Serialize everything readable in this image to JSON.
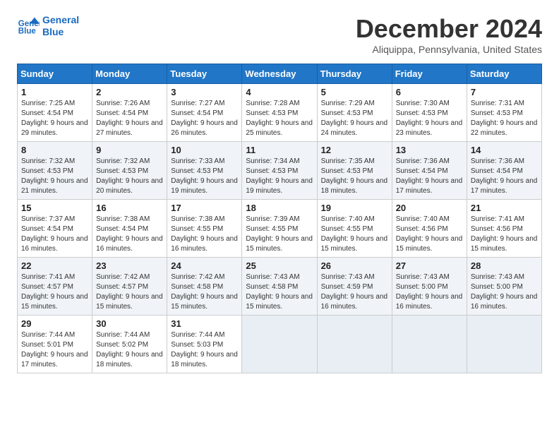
{
  "header": {
    "logo_line1": "General",
    "logo_line2": "Blue",
    "title": "December 2024",
    "subtitle": "Aliquippa, Pennsylvania, United States"
  },
  "columns": [
    "Sunday",
    "Monday",
    "Tuesday",
    "Wednesday",
    "Thursday",
    "Friday",
    "Saturday"
  ],
  "weeks": [
    [
      {
        "day": "1",
        "sunrise": "Sunrise: 7:25 AM",
        "sunset": "Sunset: 4:54 PM",
        "daylight": "Daylight: 9 hours and 29 minutes."
      },
      {
        "day": "2",
        "sunrise": "Sunrise: 7:26 AM",
        "sunset": "Sunset: 4:54 PM",
        "daylight": "Daylight: 9 hours and 27 minutes."
      },
      {
        "day": "3",
        "sunrise": "Sunrise: 7:27 AM",
        "sunset": "Sunset: 4:54 PM",
        "daylight": "Daylight: 9 hours and 26 minutes."
      },
      {
        "day": "4",
        "sunrise": "Sunrise: 7:28 AM",
        "sunset": "Sunset: 4:53 PM",
        "daylight": "Daylight: 9 hours and 25 minutes."
      },
      {
        "day": "5",
        "sunrise": "Sunrise: 7:29 AM",
        "sunset": "Sunset: 4:53 PM",
        "daylight": "Daylight: 9 hours and 24 minutes."
      },
      {
        "day": "6",
        "sunrise": "Sunrise: 7:30 AM",
        "sunset": "Sunset: 4:53 PM",
        "daylight": "Daylight: 9 hours and 23 minutes."
      },
      {
        "day": "7",
        "sunrise": "Sunrise: 7:31 AM",
        "sunset": "Sunset: 4:53 PM",
        "daylight": "Daylight: 9 hours and 22 minutes."
      }
    ],
    [
      {
        "day": "8",
        "sunrise": "Sunrise: 7:32 AM",
        "sunset": "Sunset: 4:53 PM",
        "daylight": "Daylight: 9 hours and 21 minutes."
      },
      {
        "day": "9",
        "sunrise": "Sunrise: 7:32 AM",
        "sunset": "Sunset: 4:53 PM",
        "daylight": "Daylight: 9 hours and 20 minutes."
      },
      {
        "day": "10",
        "sunrise": "Sunrise: 7:33 AM",
        "sunset": "Sunset: 4:53 PM",
        "daylight": "Daylight: 9 hours and 19 minutes."
      },
      {
        "day": "11",
        "sunrise": "Sunrise: 7:34 AM",
        "sunset": "Sunset: 4:53 PM",
        "daylight": "Daylight: 9 hours and 19 minutes."
      },
      {
        "day": "12",
        "sunrise": "Sunrise: 7:35 AM",
        "sunset": "Sunset: 4:53 PM",
        "daylight": "Daylight: 9 hours and 18 minutes."
      },
      {
        "day": "13",
        "sunrise": "Sunrise: 7:36 AM",
        "sunset": "Sunset: 4:54 PM",
        "daylight": "Daylight: 9 hours and 17 minutes."
      },
      {
        "day": "14",
        "sunrise": "Sunrise: 7:36 AM",
        "sunset": "Sunset: 4:54 PM",
        "daylight": "Daylight: 9 hours and 17 minutes."
      }
    ],
    [
      {
        "day": "15",
        "sunrise": "Sunrise: 7:37 AM",
        "sunset": "Sunset: 4:54 PM",
        "daylight": "Daylight: 9 hours and 16 minutes."
      },
      {
        "day": "16",
        "sunrise": "Sunrise: 7:38 AM",
        "sunset": "Sunset: 4:54 PM",
        "daylight": "Daylight: 9 hours and 16 minutes."
      },
      {
        "day": "17",
        "sunrise": "Sunrise: 7:38 AM",
        "sunset": "Sunset: 4:55 PM",
        "daylight": "Daylight: 9 hours and 16 minutes."
      },
      {
        "day": "18",
        "sunrise": "Sunrise: 7:39 AM",
        "sunset": "Sunset: 4:55 PM",
        "daylight": "Daylight: 9 hours and 15 minutes."
      },
      {
        "day": "19",
        "sunrise": "Sunrise: 7:40 AM",
        "sunset": "Sunset: 4:55 PM",
        "daylight": "Daylight: 9 hours and 15 minutes."
      },
      {
        "day": "20",
        "sunrise": "Sunrise: 7:40 AM",
        "sunset": "Sunset: 4:56 PM",
        "daylight": "Daylight: 9 hours and 15 minutes."
      },
      {
        "day": "21",
        "sunrise": "Sunrise: 7:41 AM",
        "sunset": "Sunset: 4:56 PM",
        "daylight": "Daylight: 9 hours and 15 minutes."
      }
    ],
    [
      {
        "day": "22",
        "sunrise": "Sunrise: 7:41 AM",
        "sunset": "Sunset: 4:57 PM",
        "daylight": "Daylight: 9 hours and 15 minutes."
      },
      {
        "day": "23",
        "sunrise": "Sunrise: 7:42 AM",
        "sunset": "Sunset: 4:57 PM",
        "daylight": "Daylight: 9 hours and 15 minutes."
      },
      {
        "day": "24",
        "sunrise": "Sunrise: 7:42 AM",
        "sunset": "Sunset: 4:58 PM",
        "daylight": "Daylight: 9 hours and 15 minutes."
      },
      {
        "day": "25",
        "sunrise": "Sunrise: 7:43 AM",
        "sunset": "Sunset: 4:58 PM",
        "daylight": "Daylight: 9 hours and 15 minutes."
      },
      {
        "day": "26",
        "sunrise": "Sunrise: 7:43 AM",
        "sunset": "Sunset: 4:59 PM",
        "daylight": "Daylight: 9 hours and 16 minutes."
      },
      {
        "day": "27",
        "sunrise": "Sunrise: 7:43 AM",
        "sunset": "Sunset: 5:00 PM",
        "daylight": "Daylight: 9 hours and 16 minutes."
      },
      {
        "day": "28",
        "sunrise": "Sunrise: 7:43 AM",
        "sunset": "Sunset: 5:00 PM",
        "daylight": "Daylight: 9 hours and 16 minutes."
      }
    ],
    [
      {
        "day": "29",
        "sunrise": "Sunrise: 7:44 AM",
        "sunset": "Sunset: 5:01 PM",
        "daylight": "Daylight: 9 hours and 17 minutes."
      },
      {
        "day": "30",
        "sunrise": "Sunrise: 7:44 AM",
        "sunset": "Sunset: 5:02 PM",
        "daylight": "Daylight: 9 hours and 18 minutes."
      },
      {
        "day": "31",
        "sunrise": "Sunrise: 7:44 AM",
        "sunset": "Sunset: 5:03 PM",
        "daylight": "Daylight: 9 hours and 18 minutes."
      },
      null,
      null,
      null,
      null
    ]
  ]
}
